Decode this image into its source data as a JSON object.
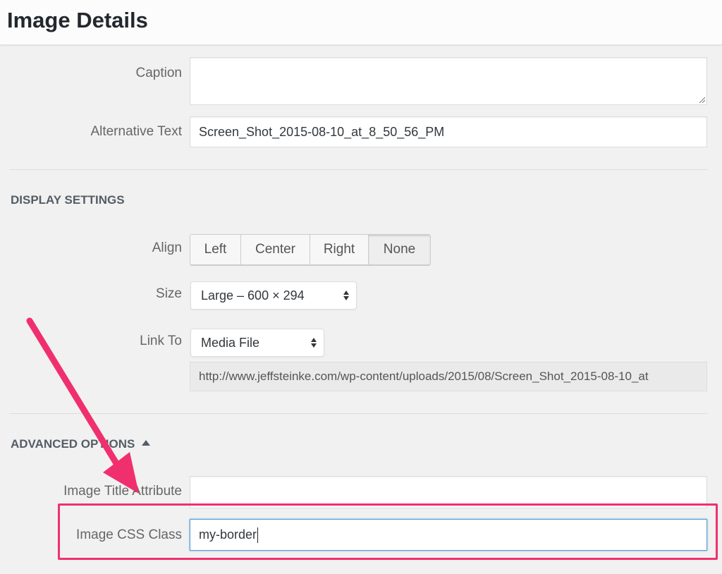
{
  "header": {
    "title": "Image Details"
  },
  "fields": {
    "caption": {
      "label": "Caption",
      "value": ""
    },
    "alt_text": {
      "label": "Alternative Text",
      "value": "Screen_Shot_2015-08-10_at_8_50_56_PM"
    }
  },
  "display_settings": {
    "heading": "DISPLAY SETTINGS",
    "align": {
      "label": "Align",
      "options": [
        "Left",
        "Center",
        "Right",
        "None"
      ],
      "selected": "None"
    },
    "size": {
      "label": "Size",
      "value": "Large – 600 × 294"
    },
    "link_to": {
      "label": "Link To",
      "value": "Media File",
      "url": "http://www.jeffsteinke.com/wp-content/uploads/2015/08/Screen_Shot_2015-08-10_at"
    }
  },
  "advanced_options": {
    "heading": "ADVANCED OPTIONS",
    "title_attribute": {
      "label": "Image Title Attribute",
      "value": ""
    },
    "css_class": {
      "label": "Image CSS Class",
      "value": "my-border"
    }
  },
  "annotation": {
    "color": "#f0306e"
  },
  "colors": {
    "focus_border": "#5b9dd9",
    "divider": "#dddddd",
    "background": "#f1f1f1"
  },
  "icons": {
    "select_arrows": "select-arrows-icon",
    "toggle": "triangle-up-icon",
    "resize": "resize-handle-icon"
  }
}
